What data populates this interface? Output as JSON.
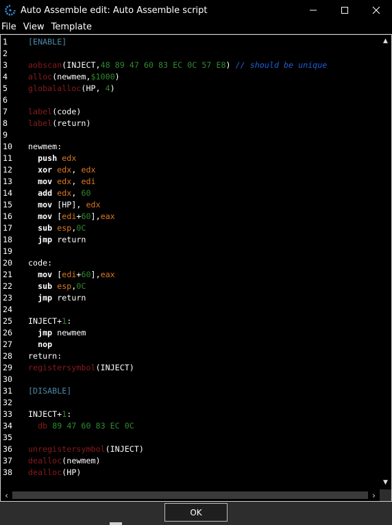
{
  "window": {
    "title": "Auto Assemble edit: Auto Assemble script",
    "minimize_glyph": "—",
    "maximize_glyph": "☐",
    "close_glyph": "✕"
  },
  "menu": {
    "items": [
      "File",
      "View",
      "Template"
    ]
  },
  "colors": {
    "plain": "#ffffff",
    "keyword": "#8b1a1a",
    "section": "#4a8aa8",
    "number": "#2e8b2e",
    "register": "#e07820",
    "comment": "#1e60d8",
    "asm": "#ffffff"
  },
  "editor": {
    "lines": [
      {
        "n": "1",
        "t": [
          [
            "section",
            "[ENABLE]"
          ]
        ]
      },
      {
        "n": "2",
        "t": []
      },
      {
        "n": "3",
        "t": [
          [
            "keyword",
            "aobscan"
          ],
          [
            "plain",
            "(INJECT,"
          ],
          [
            "number",
            "48 89 47 60 83 EC 0C 57 E8"
          ],
          [
            "plain",
            ") "
          ],
          [
            "comment",
            "// should be unique"
          ]
        ]
      },
      {
        "n": "4",
        "t": [
          [
            "keyword",
            "alloc"
          ],
          [
            "plain",
            "(newmem,"
          ],
          [
            "number",
            "$1000"
          ],
          [
            "plain",
            ")"
          ]
        ]
      },
      {
        "n": "5",
        "t": [
          [
            "keyword",
            "globalalloc"
          ],
          [
            "plain",
            "(HP, "
          ],
          [
            "number",
            "4"
          ],
          [
            "plain",
            ")"
          ]
        ]
      },
      {
        "n": "6",
        "t": []
      },
      {
        "n": "7",
        "t": [
          [
            "keyword",
            "label"
          ],
          [
            "plain",
            "(code)"
          ]
        ]
      },
      {
        "n": "8",
        "t": [
          [
            "keyword",
            "label"
          ],
          [
            "plain",
            "(return)"
          ]
        ]
      },
      {
        "n": "9",
        "t": []
      },
      {
        "n": "10",
        "t": [
          [
            "plain",
            "newmem:"
          ]
        ]
      },
      {
        "n": "11",
        "t": [
          [
            "plain",
            "  "
          ],
          [
            "asm",
            "push "
          ],
          [
            "register",
            "edx"
          ]
        ]
      },
      {
        "n": "12",
        "t": [
          [
            "plain",
            "  "
          ],
          [
            "asm",
            "xor "
          ],
          [
            "register",
            "edx"
          ],
          [
            "plain",
            ", "
          ],
          [
            "register",
            "edx"
          ]
        ]
      },
      {
        "n": "13",
        "t": [
          [
            "plain",
            "  "
          ],
          [
            "asm",
            "mov "
          ],
          [
            "register",
            "edx"
          ],
          [
            "plain",
            ", "
          ],
          [
            "register",
            "edi"
          ]
        ]
      },
      {
        "n": "14",
        "t": [
          [
            "plain",
            "  "
          ],
          [
            "asm",
            "add "
          ],
          [
            "register",
            "edx"
          ],
          [
            "plain",
            ", "
          ],
          [
            "number",
            "60"
          ]
        ]
      },
      {
        "n": "15",
        "t": [
          [
            "plain",
            "  "
          ],
          [
            "asm",
            "mov "
          ],
          [
            "plain",
            "[HP], "
          ],
          [
            "register",
            "edx"
          ]
        ]
      },
      {
        "n": "16",
        "t": [
          [
            "plain",
            "  "
          ],
          [
            "asm",
            "mov "
          ],
          [
            "plain",
            "["
          ],
          [
            "register",
            "edi"
          ],
          [
            "plain",
            "+"
          ],
          [
            "number",
            "60"
          ],
          [
            "plain",
            "],"
          ],
          [
            "register",
            "eax"
          ]
        ]
      },
      {
        "n": "17",
        "t": [
          [
            "plain",
            "  "
          ],
          [
            "asm",
            "sub "
          ],
          [
            "register",
            "esp"
          ],
          [
            "plain",
            ","
          ],
          [
            "number",
            "0C"
          ]
        ]
      },
      {
        "n": "18",
        "t": [
          [
            "plain",
            "  "
          ],
          [
            "asm",
            "jmp "
          ],
          [
            "plain",
            "return"
          ]
        ]
      },
      {
        "n": "19",
        "t": []
      },
      {
        "n": "20",
        "t": [
          [
            "plain",
            "code:"
          ]
        ]
      },
      {
        "n": "21",
        "t": [
          [
            "plain",
            "  "
          ],
          [
            "asm",
            "mov "
          ],
          [
            "plain",
            "["
          ],
          [
            "register",
            "edi"
          ],
          [
            "plain",
            "+"
          ],
          [
            "number",
            "60"
          ],
          [
            "plain",
            "],"
          ],
          [
            "register",
            "eax"
          ]
        ]
      },
      {
        "n": "22",
        "t": [
          [
            "plain",
            "  "
          ],
          [
            "asm",
            "sub "
          ],
          [
            "register",
            "esp"
          ],
          [
            "plain",
            ","
          ],
          [
            "number",
            "0C"
          ]
        ]
      },
      {
        "n": "23",
        "t": [
          [
            "plain",
            "  "
          ],
          [
            "asm",
            "jmp "
          ],
          [
            "plain",
            "return"
          ]
        ]
      },
      {
        "n": "24",
        "t": []
      },
      {
        "n": "25",
        "t": [
          [
            "plain",
            "INJECT+"
          ],
          [
            "number",
            "1"
          ],
          [
            "plain",
            ":"
          ]
        ]
      },
      {
        "n": "26",
        "t": [
          [
            "plain",
            "  "
          ],
          [
            "asm",
            "jmp "
          ],
          [
            "plain",
            "newmem"
          ]
        ]
      },
      {
        "n": "27",
        "t": [
          [
            "plain",
            "  "
          ],
          [
            "asm",
            "nop"
          ]
        ]
      },
      {
        "n": "28",
        "t": [
          [
            "plain",
            "return:"
          ]
        ]
      },
      {
        "n": "29",
        "t": [
          [
            "keyword",
            "registersymbol"
          ],
          [
            "plain",
            "(INJECT)"
          ]
        ]
      },
      {
        "n": "30",
        "t": []
      },
      {
        "n": "31",
        "t": [
          [
            "section",
            "[DISABLE]"
          ]
        ]
      },
      {
        "n": "32",
        "t": []
      },
      {
        "n": "33",
        "t": [
          [
            "plain",
            "INJECT+"
          ],
          [
            "number",
            "1"
          ],
          [
            "plain",
            ":"
          ]
        ]
      },
      {
        "n": "34",
        "t": [
          [
            "plain",
            "  "
          ],
          [
            "keyword",
            "db "
          ],
          [
            "number",
            "89 47 60 83 EC 0C"
          ]
        ]
      },
      {
        "n": "35",
        "t": []
      },
      {
        "n": "36",
        "t": [
          [
            "keyword",
            "unregistersymbol"
          ],
          [
            "plain",
            "(INJECT)"
          ]
        ]
      },
      {
        "n": "37",
        "t": [
          [
            "keyword",
            "dealloc"
          ],
          [
            "plain",
            "(newmem)"
          ]
        ]
      },
      {
        "n": "38",
        "t": [
          [
            "keyword",
            "dealloc"
          ],
          [
            "plain",
            "(HP)"
          ]
        ]
      }
    ]
  },
  "scrollbars": {
    "up_glyph": "▲",
    "down_glyph": "▼",
    "left_glyph": "‹",
    "right_glyph": "›"
  },
  "footer": {
    "ok_label": "OK"
  }
}
